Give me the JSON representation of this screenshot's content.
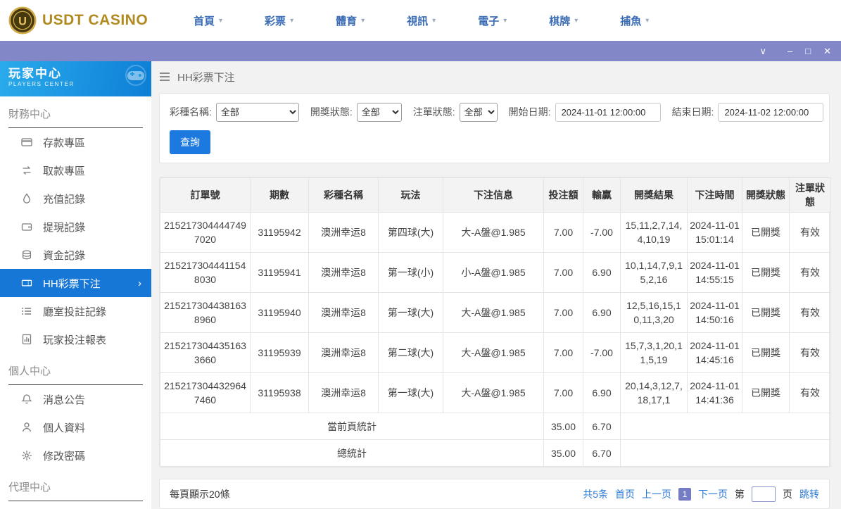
{
  "colors": {
    "accent_blue": "#1777d6",
    "nav_blue": "#3a6cb5",
    "titlebar_purple": "#8287c8",
    "brand_gold": "#b08a1e",
    "link_blue": "#2a7bd5",
    "current_page_bg": "#747cc4"
  },
  "brand": {
    "name": "USDT CASINO"
  },
  "topnav": {
    "items": [
      "首頁",
      "彩票",
      "體育",
      "視訊",
      "電子",
      "棋牌",
      "捕魚"
    ]
  },
  "sidebar": {
    "title": "玩家中心",
    "subtitle": "PLAYERS CENTER",
    "sections": [
      {
        "label": "財務中心",
        "items": [
          {
            "label": "存款專區",
            "icon": "deposit-card-icon"
          },
          {
            "label": "取款專區",
            "icon": "withdraw-arrows-icon"
          },
          {
            "label": "充值記錄",
            "icon": "recharge-drop-icon"
          },
          {
            "label": "提現記錄",
            "icon": "wallet-icon"
          },
          {
            "label": "資金記錄",
            "icon": "funds-coins-icon"
          },
          {
            "label": "HH彩票下注",
            "icon": "lottery-ticket-icon",
            "active": true
          },
          {
            "label": "廳室投註記錄",
            "icon": "hall-list-icon"
          },
          {
            "label": "玩家投注報表",
            "icon": "report-chart-icon"
          }
        ]
      },
      {
        "label": "個人中心",
        "items": [
          {
            "label": "消息公告",
            "icon": "bell-icon"
          },
          {
            "label": "個人資料",
            "icon": "user-icon"
          },
          {
            "label": "修改密碼",
            "icon": "gear-icon"
          }
        ]
      },
      {
        "label": "代理中心",
        "items": []
      }
    ]
  },
  "breadcrumb": {
    "title": "HH彩票下注"
  },
  "filters": {
    "lottery_label": "彩種名稱:",
    "lottery_value": "全部",
    "draw_status_label": "開獎狀態:",
    "draw_status_value": "全部",
    "order_status_label": "注單狀態:",
    "order_status_value": "全部",
    "start_label": "開始日期:",
    "start_value": "2024-11-01 12:00:00",
    "end_label": "結束日期:",
    "end_value": "2024-11-02 12:00:00",
    "search_button": "查詢"
  },
  "table": {
    "headers": [
      "訂單號",
      "期數",
      "彩種名稱",
      "玩法",
      "下注信息",
      "投注額",
      "輸贏",
      "開獎結果",
      "下注時間",
      "開獎狀態",
      "注單狀態"
    ],
    "keys": [
      "order_no",
      "period",
      "lottery_name",
      "play_type",
      "bet_info",
      "bet_amount",
      "win_loss",
      "draw_result",
      "bet_time",
      "draw_status",
      "order_status"
    ],
    "rows": [
      [
        "2152173044447497020",
        "31195942",
        "澳洲幸运8",
        "第四球(大)",
        "大-A盤@1.985",
        "7.00",
        "-7.00",
        "15,11,2,7,14,4,10,19",
        "2024-11-01 15:01:14",
        "已開獎",
        "有效"
      ],
      [
        "2152173044411548030",
        "31195941",
        "澳洲幸运8",
        "第一球(小)",
        "小-A盤@1.985",
        "7.00",
        "6.90",
        "10,1,14,7,9,15,2,16",
        "2024-11-01 14:55:15",
        "已開獎",
        "有效"
      ],
      [
        "2152173044381638960",
        "31195940",
        "澳洲幸运8",
        "第一球(大)",
        "大-A盤@1.985",
        "7.00",
        "6.90",
        "12,5,16,15,10,11,3,20",
        "2024-11-01 14:50:16",
        "已開獎",
        "有效"
      ],
      [
        "2152173044351633660",
        "31195939",
        "澳洲幸运8",
        "第二球(大)",
        "大-A盤@1.985",
        "7.00",
        "-7.00",
        "15,7,3,1,20,11,5,19",
        "2024-11-01 14:45:16",
        "已開獎",
        "有效"
      ],
      [
        "2152173044329647460",
        "31195938",
        "澳洲幸运8",
        "第一球(大)",
        "大-A盤@1.985",
        "7.00",
        "6.90",
        "20,14,3,12,7,18,17,1",
        "2024-11-01 14:41:36",
        "已開獎",
        "有效"
      ]
    ],
    "page_total": {
      "label": "當前頁統計",
      "bet_amount": "35.00",
      "win_loss": "6.70"
    },
    "grand_total": {
      "label": "總統計",
      "bet_amount": "35.00",
      "win_loss": "6.70"
    }
  },
  "pagination": {
    "page_size_text": "每頁顯示20條",
    "total_text": "共5条",
    "first": "首页",
    "prev": "上一页",
    "current": "1",
    "next": "下一页",
    "jump_prefix": "第",
    "jump_suffix": "页",
    "jump_action": "跳转"
  }
}
